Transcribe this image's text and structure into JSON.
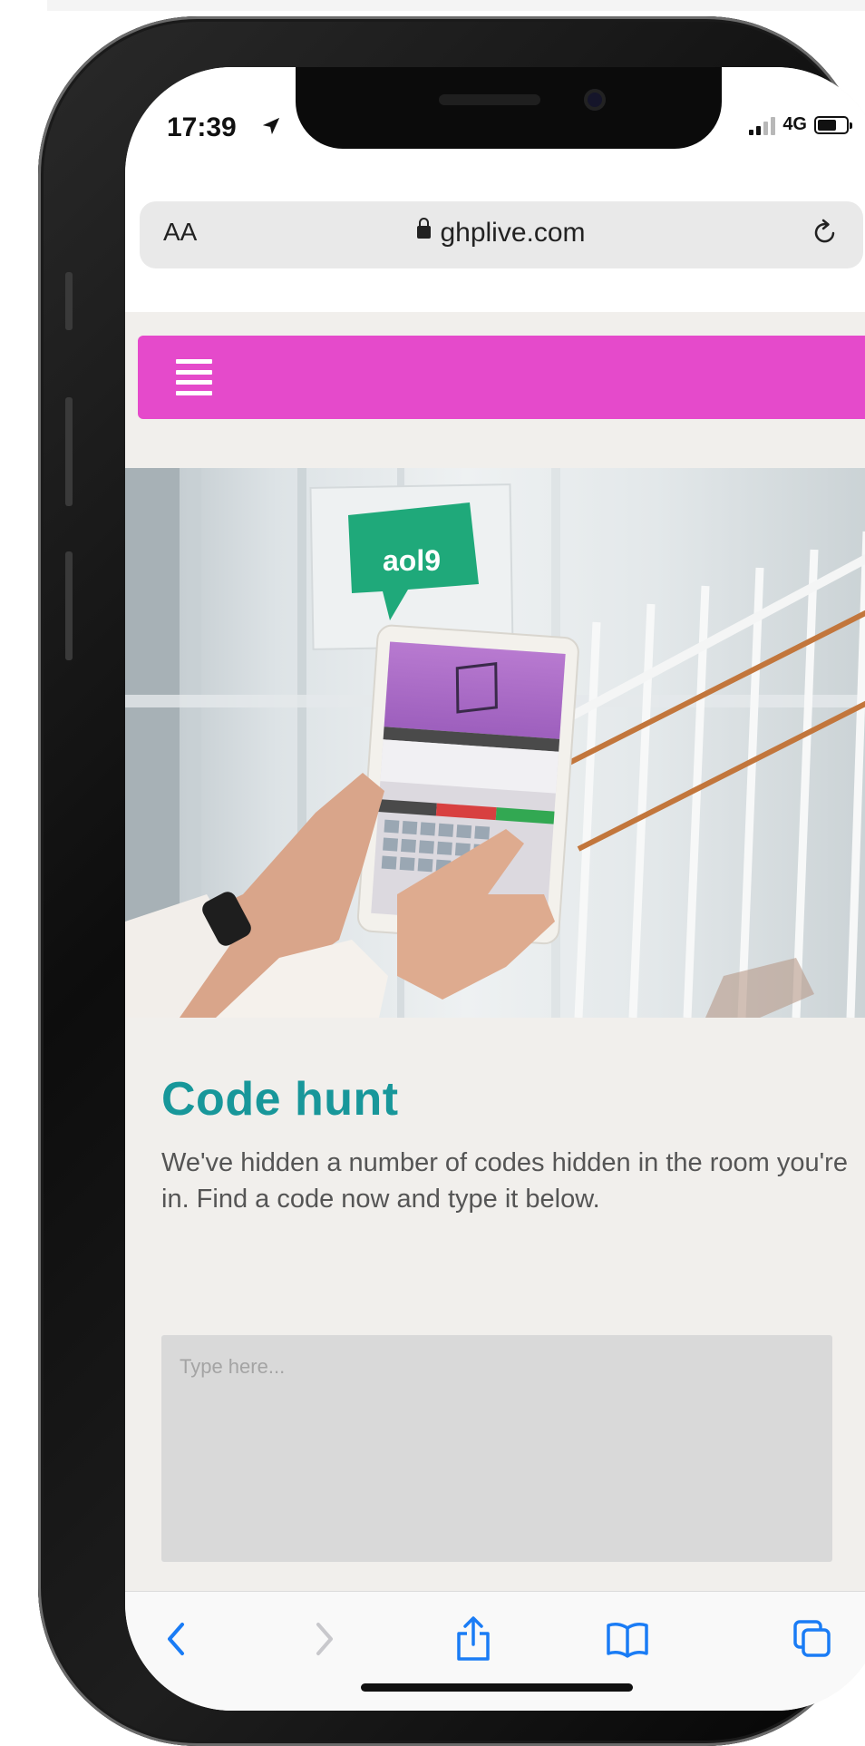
{
  "status_bar": {
    "time": "17:39",
    "network": "4G"
  },
  "browser": {
    "text_size_label": "AA",
    "url": "ghplive.com"
  },
  "page": {
    "title": "Code hunt",
    "description": "We've hidden a number of codes hidden in the room you're in. Find a code now and type it below.",
    "input_placeholder": "Type here...",
    "hero_sign_code": "aol9"
  },
  "colors": {
    "nav_bar": "#e54acb",
    "title": "#18979a",
    "toolbar_icons": "#1a7cf5"
  },
  "icons": {
    "menu": "hamburger-icon",
    "back": "chevron-left-icon",
    "forward": "chevron-right-icon",
    "share": "share-icon",
    "bookmarks": "book-icon",
    "tabs": "tabs-icon"
  }
}
